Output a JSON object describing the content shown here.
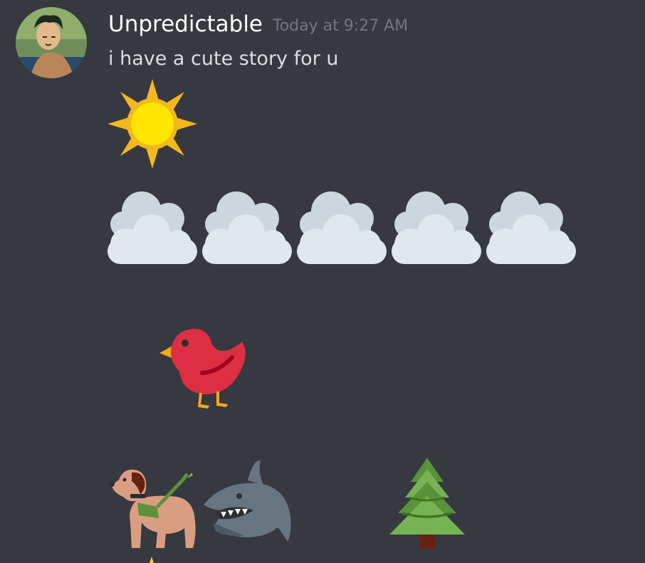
{
  "message": {
    "author": "Unpredictable",
    "timestamp": "Today at 9:27 AM",
    "text": "i have a cute story for u"
  },
  "emoji_rows": [
    {
      "row": 1,
      "emojis": [
        "sun-icon"
      ]
    },
    {
      "row": 2,
      "emojis": [
        "cloud-icon",
        "cloud-icon",
        "cloud-icon",
        "cloud-icon",
        "cloud-icon"
      ]
    },
    {
      "row": 3,
      "emojis": [
        "bird-icon"
      ]
    },
    {
      "row": 4,
      "emojis": [
        "guide-dog-icon",
        "shark-icon",
        "evergreen-tree-icon"
      ]
    }
  ],
  "colors": {
    "background": "#36393f",
    "username": "#ffffff",
    "timestamp": "#72767d",
    "message_text": "#dcddde"
  }
}
